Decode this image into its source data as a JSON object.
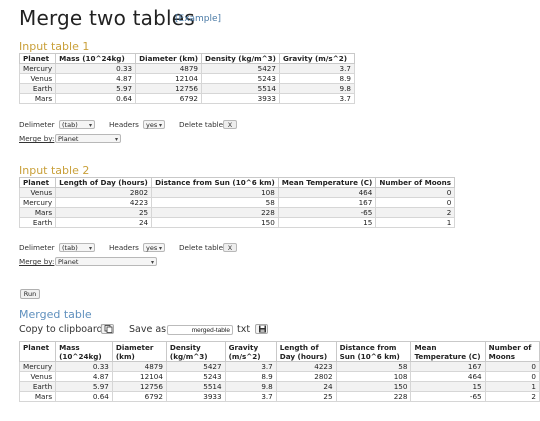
{
  "page": {
    "title": "Merge two tables",
    "example_link": "[Example]"
  },
  "input1": {
    "heading": "Input table 1",
    "headers": [
      "Planet",
      "Mass (10^24kg)",
      "Diameter (km)",
      "Density (kg/m^3)",
      "Gravity (m/s^2)"
    ],
    "rows": [
      [
        "Mercury",
        "0.33",
        "4879",
        "5427",
        "3.7"
      ],
      [
        "Venus",
        "4.87",
        "12104",
        "5243",
        "8.9"
      ],
      [
        "Earth",
        "5.97",
        "12756",
        "5514",
        "9.8"
      ],
      [
        "Mars",
        "0.64",
        "6792",
        "3933",
        "3.7"
      ]
    ],
    "delimiter_label": "Delimeter",
    "delimiter_value": "(tab)",
    "headers_label": "Headers",
    "headers_value": "yes",
    "delete_label": "Delete table",
    "delete_button": "X",
    "merge_by_label": "Merge by:",
    "merge_by_value": "Planet"
  },
  "input2": {
    "heading": "Input table 2",
    "headers": [
      "Planet",
      "Length of Day (hours)",
      "Distance from Sun (10^6 km)",
      "Mean Temperature (C)",
      "Number of Moons"
    ],
    "rows": [
      [
        "Venus",
        "2802",
        "108",
        "464",
        "0"
      ],
      [
        "Mercury",
        "4223",
        "58",
        "167",
        "0"
      ],
      [
        "Mars",
        "25",
        "228",
        "-65",
        "2"
      ],
      [
        "Earth",
        "24",
        "150",
        "15",
        "1"
      ]
    ],
    "delimiter_label": "Delimeter",
    "delimiter_value": "(tab)",
    "headers_label": "Headers",
    "headers_value": "yes",
    "delete_label": "Delete table",
    "delete_button": "X",
    "merge_by_label": "Merge by:",
    "merge_by_value": "Planet"
  },
  "run_button": "Run",
  "merged": {
    "heading": "Merged table",
    "copy_label": "Copy to clipboard",
    "save_label": "Save as",
    "filename": "merged-table",
    "ext": "txt",
    "headers": [
      "Planet",
      "Mass (10^24kg)",
      "Diameter (km)",
      "Density (kg/m^3)",
      "Gravity (m/s^2)",
      "Length of Day (hours)",
      "Distance from Sun (10^6 km)",
      "Mean Temperature (C)",
      "Number of Moons"
    ],
    "rows": [
      [
        "Mercury",
        "0.33",
        "4879",
        "5427",
        "3.7",
        "4223",
        "58",
        "167",
        "0"
      ],
      [
        "Venus",
        "4.87",
        "12104",
        "5243",
        "8.9",
        "2802",
        "108",
        "464",
        "0"
      ],
      [
        "Earth",
        "5.97",
        "12756",
        "5514",
        "9.8",
        "24",
        "150",
        "15",
        "1"
      ],
      [
        "Mars",
        "0.64",
        "6792",
        "3933",
        "3.7",
        "25",
        "228",
        "-65",
        "2"
      ]
    ]
  },
  "icons": {
    "copy": "copy-icon",
    "save": "save-disk-icon",
    "chevron": "chevron-down-icon"
  }
}
